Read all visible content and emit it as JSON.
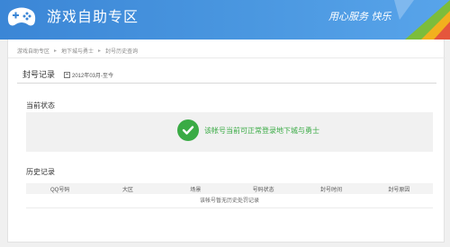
{
  "header": {
    "title": "游戏自助专区",
    "slogan": "用心服务 快乐",
    "logo_icon": "gamepad-icon"
  },
  "breadcrumb": [
    "游戏自助专区",
    "地下城与勇士",
    "封号历史查询"
  ],
  "section": {
    "title": "封号记录",
    "period": "2012年03月-至今"
  },
  "current_status": {
    "title": "当前状态",
    "message": "该帐号当前可正常登录地下城与勇士",
    "icon": "checkmark-icon",
    "color": "#3aab45"
  },
  "history": {
    "title": "历史记录",
    "columns": [
      "QQ号码",
      "大区",
      "场景",
      "号码状态",
      "封号时间",
      "封号原因"
    ],
    "empty_text": "该帐号暂无历史处罚记录"
  }
}
